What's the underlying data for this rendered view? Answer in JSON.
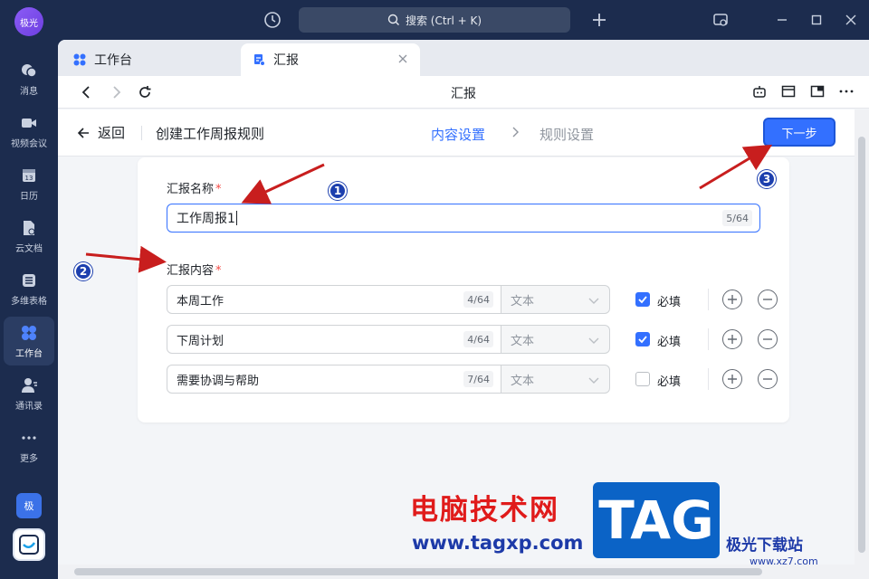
{
  "sidebar": {
    "avatar": "极光",
    "items": [
      {
        "label": "消息",
        "icon": "message-icon"
      },
      {
        "label": "视频会议",
        "icon": "video-icon"
      },
      {
        "label": "日历",
        "icon": "calendar-icon"
      },
      {
        "label": "云文档",
        "icon": "cloud-doc-icon"
      },
      {
        "label": "多维表格",
        "icon": "table-icon"
      },
      {
        "label": "工作台",
        "icon": "workspace-icon",
        "active": true
      },
      {
        "label": "通讯录",
        "icon": "contacts-icon"
      },
      {
        "label": "更多",
        "icon": "more-icon"
      }
    ],
    "mini_app": "极"
  },
  "titlebar": {
    "search_placeholder": "搜索 (Ctrl + K)"
  },
  "tabs": [
    {
      "label": "工作台",
      "icon": "workspace-icon"
    },
    {
      "label": "汇报",
      "icon": "report-icon",
      "active": true
    }
  ],
  "navbar": {
    "title": "汇报"
  },
  "header": {
    "back_label": "返回",
    "page_title": "创建工作周报规则",
    "step1": "内容设置",
    "step2": "规则设置",
    "next_label": "下一步"
  },
  "form": {
    "name_label": "汇报名称",
    "name_value": "工作周报1",
    "name_counter": "5/64",
    "content_label": "汇报内容",
    "required_mark": "*",
    "rows": [
      {
        "value": "本周工作",
        "counter": "4/64",
        "type": "文本",
        "required_label": "必填",
        "checked": true
      },
      {
        "value": "下周计划",
        "counter": "4/64",
        "type": "文本",
        "required_label": "必填",
        "checked": true
      },
      {
        "value": "需要协调与帮助",
        "counter": "7/64",
        "type": "文本",
        "required_label": "必填",
        "checked": false
      }
    ]
  },
  "annotations": [
    "1",
    "2",
    "3"
  ],
  "watermark": {
    "cn": "电脑技术网",
    "url": "www.tagxp.com",
    "tag": "TAG",
    "site2": "极光下载站",
    "site2_url": "www.xz7.com"
  },
  "colors": {
    "accent": "#3370ff",
    "sidebar_bg": "#1c2c4e",
    "required": "#f54a45",
    "arrow": "#c81e1e"
  }
}
